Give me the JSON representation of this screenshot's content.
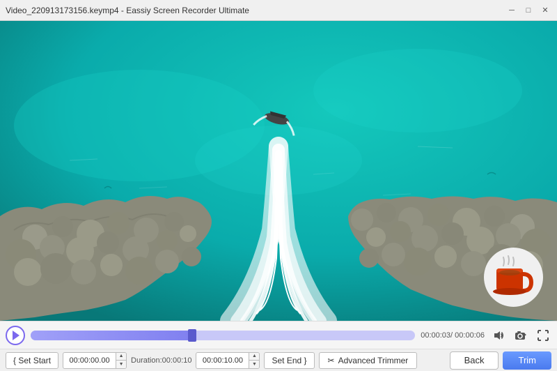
{
  "titleBar": {
    "title": "Video_220913173156.keymp4  -  Eassiy Screen Recorder Ultimate",
    "minimizeLabel": "─",
    "maximizeLabel": "□",
    "closeLabel": "✕"
  },
  "video": {
    "currentTime": "00:00:03",
    "totalTime": "00:00:06",
    "progressPercent": 42
  },
  "bottomToolbar": {
    "setStartLabel": "{ Set Start",
    "startTimeValue": "00:00:00.00",
    "durationLabel": "Duration:00:00:10",
    "endTimeValue": "00:00:10.00",
    "setEndLabel": "Set End }",
    "advancedLabel": "Advanced Trimmer",
    "backLabel": "Back",
    "trimLabel": "Trim"
  },
  "icons": {
    "play": "play-icon",
    "volume": "🔊",
    "camera": "📷",
    "fullscreen": "⛶",
    "scissors": "✂"
  }
}
